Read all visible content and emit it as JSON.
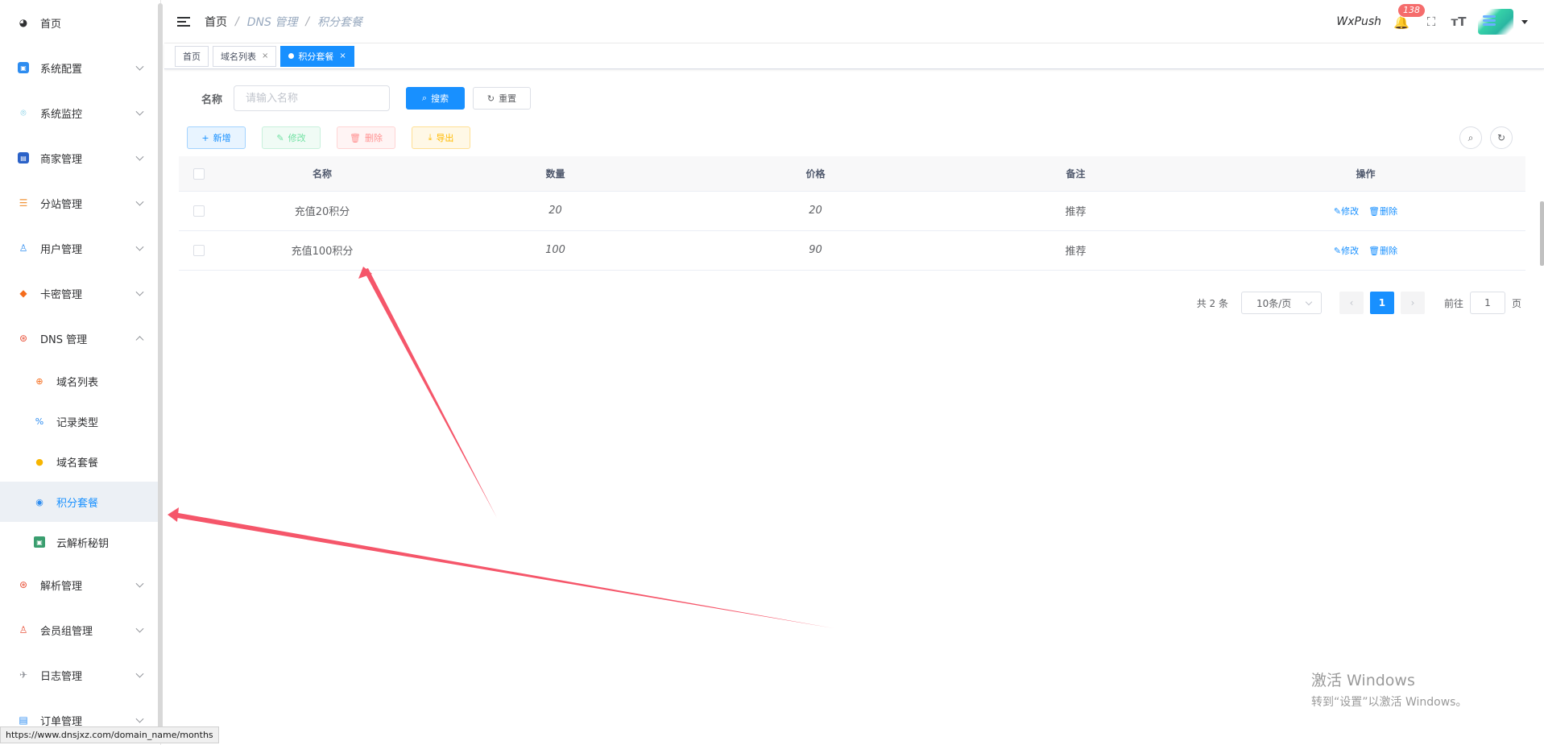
{
  "sidebar": {
    "items": [
      {
        "label": "首页",
        "icon": "dashboard-icon",
        "color": "#303133"
      },
      {
        "label": "系统配置",
        "icon": "monitor-icon",
        "color": "#2d8cf0"
      },
      {
        "label": "系统监控",
        "icon": "radar-icon",
        "color": "#5bc0de"
      },
      {
        "label": "商家管理",
        "icon": "store-icon",
        "color": "#2b62c8"
      },
      {
        "label": "分站管理",
        "icon": "server-icon",
        "color": "#f0953a"
      },
      {
        "label": "用户管理",
        "icon": "user-icon",
        "color": "#2d8cf0"
      },
      {
        "label": "卡密管理",
        "icon": "box-icon",
        "color": "#f56c1c"
      },
      {
        "label": "DNS 管理",
        "icon": "dns-icon",
        "color": "#e9533b"
      }
    ],
    "subitems": [
      {
        "label": "域名列表",
        "icon": "globe-icon",
        "color": "#f56c1c"
      },
      {
        "label": "记录类型",
        "icon": "percent-icon",
        "color": "#2d8cf0"
      },
      {
        "label": "域名套餐",
        "icon": "coin-icon",
        "color": "#f7b500"
      },
      {
        "label": "积分套餐",
        "icon": "target-icon",
        "color": "#2d8cf0"
      },
      {
        "label": "云解析秘钥",
        "icon": "key-icon",
        "color": "#3a9e6f"
      }
    ],
    "items_after": [
      {
        "label": "解析管理",
        "icon": "analysis-icon",
        "color": "#e9533b"
      },
      {
        "label": "会员组管理",
        "icon": "group-icon",
        "color": "#e9533b"
      },
      {
        "label": "日志管理",
        "icon": "send-icon",
        "color": "#909399"
      },
      {
        "label": "订单管理",
        "icon": "order-icon",
        "color": "#2d8cf0"
      }
    ]
  },
  "header": {
    "breadcrumb": [
      "首页",
      "DNS 管理",
      "积分套餐"
    ],
    "separator": "/",
    "wxpush": "WxPush",
    "badge_count": "138"
  },
  "tags": [
    {
      "label": "首页",
      "closable": false,
      "active": false
    },
    {
      "label": "域名列表",
      "closable": true,
      "active": false
    },
    {
      "label": "积分套餐",
      "closable": true,
      "active": true
    }
  ],
  "tag_close": "×",
  "search": {
    "label": "名称",
    "placeholder": "请输入名称",
    "value": "",
    "search_button": "搜索",
    "reset_button": "重置"
  },
  "toolbar": {
    "add": "新增",
    "edit": "修改",
    "delete": "删除",
    "export": "导出"
  },
  "table": {
    "columns": [
      "名称",
      "数量",
      "价格",
      "备注",
      "操作"
    ],
    "rows": [
      {
        "name": "充值20积分",
        "qty": "20",
        "price": "20",
        "note": "推荐"
      },
      {
        "name": "充值100积分",
        "qty": "100",
        "price": "90",
        "note": "推荐"
      }
    ],
    "edit_action": "修改",
    "delete_action": "删除"
  },
  "pagination": {
    "total": "共 2 条",
    "page_size": "10条/页",
    "current_page": "1",
    "goto_label": "前往",
    "goto_value": "1",
    "page_unit": "页"
  },
  "watermark": {
    "line1": "激活 Windows",
    "line2": "转到“设置”以激活 Windows。"
  },
  "status_url": "https://www.dnsjxz.com/domain_name/months",
  "colors": {
    "primary": "#1890ff",
    "arrow": "#f5566a",
    "active_bg": "#ecf0f5"
  }
}
